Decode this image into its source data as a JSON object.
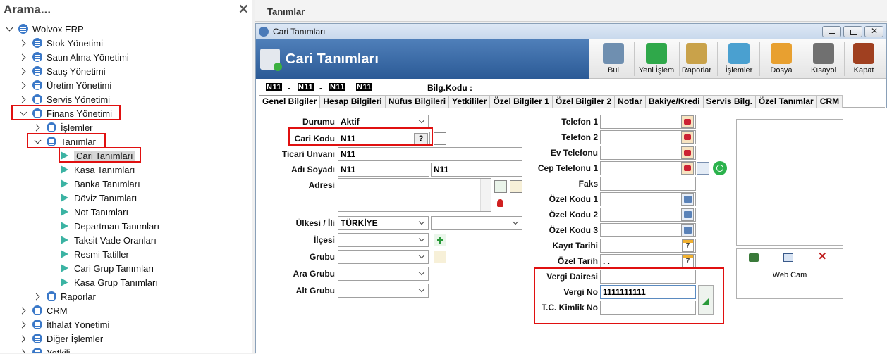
{
  "search": {
    "placeholder": "Arama...",
    "close": "✕"
  },
  "tree": [
    {
      "label": "Wolvox ERP",
      "level": 0,
      "expand": "down",
      "kind": "book"
    },
    {
      "label": "Stok Yönetimi",
      "level": 1,
      "expand": "right",
      "kind": "book"
    },
    {
      "label": "Satın Alma Yönetimi",
      "level": 1,
      "expand": "right",
      "kind": "book"
    },
    {
      "label": "Satış Yönetimi",
      "level": 1,
      "expand": "right",
      "kind": "book"
    },
    {
      "label": "Üretim Yönetimi",
      "level": 1,
      "expand": "right",
      "kind": "book"
    },
    {
      "label": "Servis Yönetimi",
      "level": 1,
      "expand": "right",
      "kind": "book"
    },
    {
      "label": "Finans Yönetimi",
      "level": 1,
      "expand": "down",
      "kind": "book"
    },
    {
      "label": "İşlemler",
      "level": 2,
      "expand": "right",
      "kind": "book"
    },
    {
      "label": "Tanımlar",
      "level": 2,
      "expand": "down",
      "kind": "book"
    },
    {
      "label": "Cari Tanımları",
      "level": 3,
      "expand": "none",
      "kind": "leaf",
      "selected": true
    },
    {
      "label": "Kasa Tanımları",
      "level": 3,
      "expand": "none",
      "kind": "leaf"
    },
    {
      "label": "Banka Tanımları",
      "level": 3,
      "expand": "none",
      "kind": "leaf"
    },
    {
      "label": "Döviz Tanımları",
      "level": 3,
      "expand": "none",
      "kind": "leaf"
    },
    {
      "label": "Not Tanımları",
      "level": 3,
      "expand": "none",
      "kind": "leaf"
    },
    {
      "label": "Departman Tanımları",
      "level": 3,
      "expand": "none",
      "kind": "leaf"
    },
    {
      "label": "Taksit Vade Oranları",
      "level": 3,
      "expand": "none",
      "kind": "leaf"
    },
    {
      "label": "Resmi Tatiller",
      "level": 3,
      "expand": "none",
      "kind": "leaf"
    },
    {
      "label": "Cari Grup Tanımları",
      "level": 3,
      "expand": "none",
      "kind": "leaf"
    },
    {
      "label": "Kasa Grup Tanımları",
      "level": 3,
      "expand": "none",
      "kind": "leaf"
    },
    {
      "label": "Raporlar",
      "level": 2,
      "expand": "right",
      "kind": "book"
    },
    {
      "label": "CRM",
      "level": 1,
      "expand": "right",
      "kind": "book"
    },
    {
      "label": "İthalat Yönetimi",
      "level": 1,
      "expand": "right",
      "kind": "book"
    },
    {
      "label": "Diğer İşlemler",
      "level": 1,
      "expand": "right",
      "kind": "book"
    },
    {
      "label": "Yetkili",
      "level": 1,
      "expand": "right",
      "kind": "book"
    }
  ],
  "page_tab": "Tanımlar",
  "window": {
    "title": "Cari Tanımları",
    "banner": "Cari Tanımları"
  },
  "toolbar": [
    {
      "label": "Bul",
      "icon": "search-user-icon",
      "color": "#6f8fb0"
    },
    {
      "label": "Yeni İşlem",
      "icon": "add-icon",
      "color": "#2fa84a"
    },
    {
      "label": "Raporlar",
      "icon": "report-icon",
      "color": "#c9a24a"
    },
    {
      "label": "İşlemler",
      "icon": "operations-icon",
      "color": "#4aa0d0"
    },
    {
      "label": "Dosya",
      "icon": "folder-icon",
      "color": "#e8a030"
    },
    {
      "label": "Kısayol",
      "icon": "keyboard-icon",
      "color": "#707070"
    },
    {
      "label": "Kapat",
      "icon": "exit-icon",
      "color": "#a04020"
    }
  ],
  "codebar": {
    "seg1": "N11",
    "seg2": "N11",
    "seg3": "N11",
    "seg4": "N11",
    "bilg_label": "Bilg.Kodu :"
  },
  "tabs": [
    "Genel Bilgiler",
    "Hesap Bilgileri",
    "Nüfus Bilgileri",
    "Yetkililer",
    "Özel Bilgiler 1",
    "Özel Bilgiler 2",
    "Notlar",
    "Bakiye/Kredi",
    "Servis Bilg.",
    "Özel Tanımlar",
    "CRM"
  ],
  "form": {
    "durumu_label": "Durumu",
    "durumu_value": "Aktif",
    "cari_kodu_label": "Cari Kodu",
    "cari_kodu_value": "N11",
    "cari_kodu_btn": "?",
    "ticari_unvan_label": "Ticari Unvanı",
    "ticari_unvan_value": "N11",
    "adi_soyadi_label": "Adı Soyadı",
    "adi_value": "N11",
    "soyadi_value": "N11",
    "adresi_label": "Adresi",
    "adresi_value": "",
    "ulke_il_label": "Ülkesi / İli",
    "ulke_value": "TÜRKİYE",
    "il_value": "",
    "ilce_label": "İlçesi",
    "grubu_label": "Grubu",
    "ara_grubu_label": "Ara Grubu",
    "alt_grubu_label": "Alt Grubu",
    "telefon1_label": "Telefon 1",
    "telefon2_label": "Telefon 2",
    "ev_telefonu_label": "Ev Telefonu",
    "cep_telefonu_label": "Cep Telefonu 1",
    "faks_label": "Faks",
    "ozel_kodu1_label": "Özel Kodu 1",
    "ozel_kodu2_label": "Özel Kodu 2",
    "ozel_kodu3_label": "Özel Kodu 3",
    "kayit_tarihi_label": "Kayıt Tarihi",
    "ozel_tarih_label": "Özel Tarih",
    "ozel_tarih_value": ". .",
    "vergi_dairesi_label": "Vergi Dairesi",
    "vergi_dairesi_value": "",
    "vergi_no_label": "Vergi No",
    "vergi_no_value": "1111111111",
    "tc_kimlik_label": "T.C. Kimlik No",
    "tc_kimlik_value": "",
    "webcam_label": "Web Cam"
  }
}
